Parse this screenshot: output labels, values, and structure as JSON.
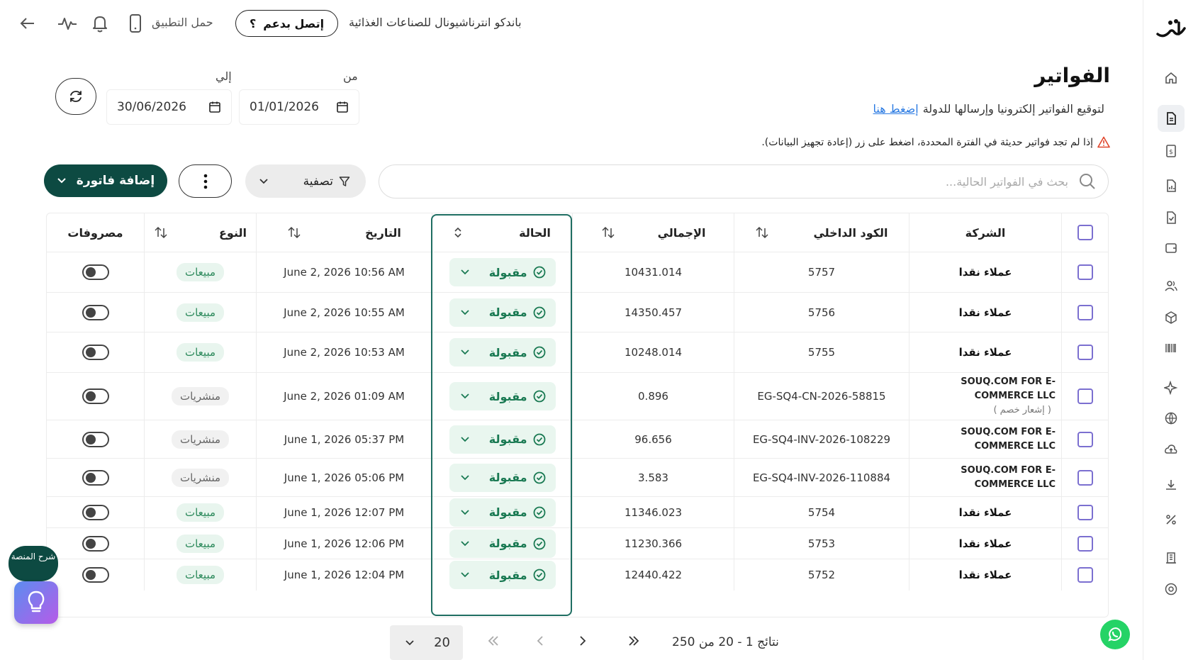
{
  "topbar": {
    "company_name": "باندكو انترناشيونال للصناعات الغذائية",
    "support_label": "إتصل بدعم",
    "support_mark": "؟",
    "app_label": "حمل التطبيق"
  },
  "page": {
    "title": "الفواتير",
    "sign_text": "لتوقيع الفواتير إلكترونيا وإرسالها للدولة",
    "sign_link": "إضغط هنا",
    "warning": "إذا لم تجد فواتير حديثة في الفترة المحددة، اضغط على زر (إعادة تجهيز البيانات)."
  },
  "dates": {
    "from_label": "من",
    "from_value": "01/01/2026",
    "to_label": "إلي",
    "to_value": "30/06/2026"
  },
  "toolbar": {
    "search_placeholder": "بحث في الفواتير الحالية...",
    "filter_label": "تصفية",
    "add_label": "إضافة فاتورة"
  },
  "table": {
    "headers": {
      "company": "الشركة",
      "internal_code": "الكود الداخلي",
      "total": "الإجمالي",
      "status": "الحالة",
      "date": "التاريخ",
      "type": "النوع",
      "expenses": "مصروفات"
    },
    "rows": [
      {
        "company": "عملاء نقدا",
        "company_note": "",
        "code": "5757",
        "total": "10431.014",
        "status": "مقبولة",
        "date": "June 2, 2026 10:56 AM",
        "type": "مبيعات"
      },
      {
        "company": "عملاء نقدا",
        "company_note": "",
        "code": "5756",
        "total": "14350.457",
        "status": "مقبولة",
        "date": "June 2, 2026 10:55 AM",
        "type": "مبيعات"
      },
      {
        "company": "عملاء نقدا",
        "company_note": "",
        "code": "5755",
        "total": "10248.014",
        "status": "مقبولة",
        "date": "June 2, 2026 10:53 AM",
        "type": "مبيعات"
      },
      {
        "company": "SOUQ.COM FOR E-COMMERCE LLC",
        "company_note": "( إشعار خصم )",
        "code": "EG-SQ4-CN-2026-58815",
        "total": "0.896",
        "status": "مقبولة",
        "date": "June 2, 2026 01:09 AM",
        "type": "منشريات"
      },
      {
        "company": "SOUQ.COM FOR E-COMMERCE LLC",
        "company_note": "",
        "code": "EG-SQ4-INV-2026-108229",
        "total": "96.656",
        "status": "مقبولة",
        "date": "June 1, 2026 05:37 PM",
        "type": "منشريات"
      },
      {
        "company": "SOUQ.COM FOR E-COMMERCE LLC",
        "company_note": "",
        "code": "EG-SQ4-INV-2026-110884",
        "total": "3.583",
        "status": "مقبولة",
        "date": "June 1, 2026 05:06 PM",
        "type": "منشريات"
      },
      {
        "company": "عملاء نقدا",
        "company_note": "",
        "code": "5754",
        "total": "11346.023",
        "status": "مقبولة",
        "date": "June 1, 2026 12:07 PM",
        "type": "مبيعات"
      },
      {
        "company": "عملاء نقدا",
        "company_note": "",
        "code": "5753",
        "total": "11230.366",
        "status": "مقبولة",
        "date": "June 1, 2026 12:06 PM",
        "type": "مبيعات"
      },
      {
        "company": "عملاء نقدا",
        "company_note": "",
        "code": "5752",
        "total": "12440.422",
        "status": "مقبولة",
        "date": "June 1, 2026 12:04 PM",
        "type": "مبيعات"
      }
    ]
  },
  "pagination": {
    "page_size": "20",
    "summary": "نتائج 1 - 20 من 250"
  },
  "help": {
    "label": "شرح المنصة"
  },
  "colors": {
    "brand": "#0d4a42",
    "accent_green": "#1a7a53",
    "checkbox": "#7b6fd0",
    "link": "#2a7ae2"
  },
  "icons": [
    "back-arrow-icon",
    "activity-icon",
    "bell-icon",
    "phone-icon",
    "refresh-icon",
    "calendar-icon",
    "search-icon",
    "filter-icon",
    "more-vertical-icon",
    "chevron-down-icon",
    "check-circle-icon",
    "sort-icon",
    "warning-icon",
    "lightbulb-icon",
    "whatsapp-icon"
  ]
}
